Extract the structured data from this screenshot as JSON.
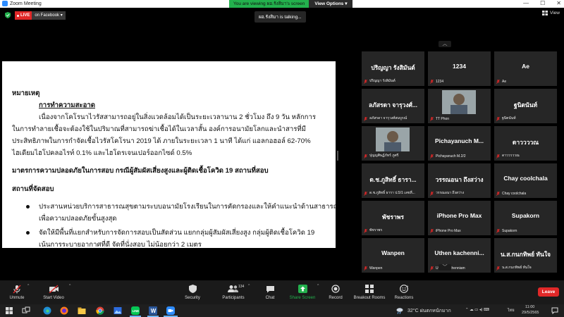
{
  "window": {
    "title": "Zoom Meeting",
    "minimize": "—",
    "maximize": "☐",
    "close": "✕"
  },
  "share_bar": {
    "viewing_text": "You are viewing ผอ.รังสิมา's screen",
    "view_options": "View Options ▾"
  },
  "live": {
    "badge": "LIVE",
    "destination": "on Facebook ▾"
  },
  "talking": "ผอ.รังสิมา is talking...",
  "view_button": "View",
  "document": {
    "heading": "หมายเหตุ",
    "subheading": "การทำความสะอาด",
    "para1": [
      "เนื่องจากโคโรนาไวรัสสามารถอยู่ในสิ่งแวดล้อมได้เป็นระยะเวลานาน 2 ชั่วโมง ถึง 9 วัน หลักการ",
      "ในการทำลายเชื้อจะต้องใช้ในปริมาณที่สามารถฆ่าเชื้อได้ในเวลาสั้น องค์การอนามัยโลกและนำสารที่มี",
      "ประสิทธิภาพในการกำจัดเชื้อไวรัสโคโรนา 2019 ได้ ภายในระยะเวลา 1 นาที ได้แก่ แอลกอฮอล์ 62-70%",
      "ไฮเดียมไฮโปคลอไรท์ 0.1% และไฮโดรเจนเปอร์ออกไซด์ 0.5%"
    ],
    "section2": "มาตรการความปลอดภัยในการสอบ กรณีผู้สัมผัสเสี่ยงสูงและผู้ติดเชื้อโควิด 19 สถานที่สอบ",
    "section3": "สถานที่จัดสอบ",
    "bullet1": [
      "ประสานหน่วยบริการสาธารณสุขตามระบบอนามัยโรงเรียนในการคัดกรองและให้คำแนะนำด้านสาธารณ",
      "เพื่อความปลอดภัยขั้นสูงสุด"
    ],
    "bullet2": [
      "จัดให้มีพื้นที่แยกสำหรับการจัดการสอบเป็นสัดส่วน แยกกลุ่มผู้สัมผัสเสี่ยงสูง กลุ่มผู้ติดเชื้อโควิด 19",
      "เน้นการระบายอากาศที่ดี จัดที่นั่งสอบ ไม่น้อยกว่า 2 เมตร"
    ]
  },
  "participants": [
    {
      "big": "ปริญญา รังสิมันต์",
      "small": "ปริญญา รังสิมันต์",
      "video": false
    },
    {
      "big": "1234",
      "small": "1234",
      "video": false
    },
    {
      "big": "Ae",
      "small": "Ae",
      "video": false
    },
    {
      "big": "ลภัสรดา จารุวงศ์...",
      "small": "ลภัสรดา จารุวงศ์สมบูรณ์",
      "video": false
    },
    {
      "big": "",
      "small": "TT Phon",
      "video": true
    },
    {
      "big": "ฐนิตนันท์",
      "small": "ฐนิตนันท์",
      "video": false
    },
    {
      "big": "",
      "small": "ปุญญศิษฏ์ภัทร์ ภูศรี",
      "video": true
    },
    {
      "big": "Pichayanuch M...",
      "small": "Pichayanuch M.2/2",
      "video": false
    },
    {
      "big": "ดาววววณ",
      "small": "ดาวววววณ",
      "video": false
    },
    {
      "big": "ด.ช.ภูสิทธิ์ ธารา...",
      "small": "ด.ช.ภูสิทธิ์ ธารา ป.5/1 เลขที่...",
      "video": false
    },
    {
      "big": "วรรณอนา ถึงสว่าง",
      "small": "วรรณอนา ถึงสว่าง",
      "video": false
    },
    {
      "big": "Chay coolchala",
      "small": "Chay coolchala",
      "video": false
    },
    {
      "big": "พัชราพร",
      "small": "พัชราพร",
      "video": false
    },
    {
      "big": "iPhone Pro Max",
      "small": "iPhone Pro Max",
      "video": false
    },
    {
      "big": "Supakorn",
      "small": "Supakorn",
      "video": false
    },
    {
      "big": "Wanpen",
      "small": "Wanpen",
      "video": false
    },
    {
      "big": "Uthen kachenni...",
      "small": "Uthen kachenniam",
      "video": false
    },
    {
      "big": "น.ส.กนกทิพย์ ทันใจ",
      "small": "น.ส.กนกทิพย์ ทันใจ",
      "video": false
    }
  ],
  "toolbar": {
    "unmute": "Unmute",
    "start_video": "Start Video",
    "security": "Security",
    "participants": "Participants",
    "participant_count": "134",
    "chat": "Chat",
    "share_screen": "Share Screen",
    "record": "Record",
    "breakout": "Breakout Rooms",
    "reactions": "Reactions",
    "leave": "Leave"
  },
  "taskbar": {
    "weather": "32°C ฝนตกหนักมาก",
    "language": "ไทย",
    "time": "11:00",
    "date": "29/5/2565"
  },
  "colors": {
    "accent": "#2d8cff",
    "live": "#e02828",
    "share_green": "#23b14d",
    "tile_bg": "#262626",
    "muted": "#e02828"
  }
}
